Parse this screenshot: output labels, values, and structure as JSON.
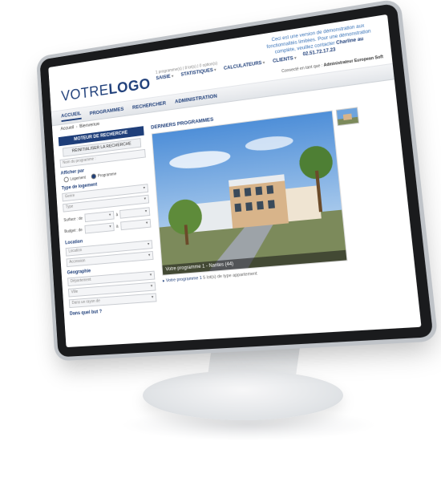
{
  "header": {
    "logo_prefix": "VOTRE",
    "logo_suffix": "LOGO",
    "demo_note": "Ceci est une version de démonstration aux fonctionnalités limitées. Pour une démonstration complète, veuillez contacter",
    "demo_contact": "Charline au 02.51.72.17.23",
    "mini_links": "1 programme(s) | 8 lot(s) | 0 option(s)",
    "connected_label": "Connecté en tant que :",
    "connected_user": "Administrateur European Soft"
  },
  "top_menu": [
    "SAISIE",
    "STATISTIQUES",
    "CALCULATEURS",
    "CLIENTS"
  ],
  "nav": {
    "items": [
      "ACCUEIL",
      "PROGRAMMES",
      "RECHERCHER",
      "ADMINISTRATION"
    ]
  },
  "breadcrumb": {
    "home": "Accueil",
    "current": "Bienvenue"
  },
  "search": {
    "title": "MOTEUR DE RECHERCHE",
    "reset": "RÉINITIALISER LA RECHERCHE",
    "program_name_placeholder": "Nom du programme :",
    "display_title": "Afficher par",
    "display_opt_1": "Logement",
    "display_opt_2": "Programme",
    "type_title": "Type de logement",
    "type_genre": "Genre",
    "type_type": "Type",
    "surface_label": "Surface : de",
    "budget_label": "Budget : de",
    "to_label": "à",
    "location_title": "Location",
    "location_field": "Location",
    "accession_field": "Accession",
    "geo_title": "Géographie",
    "dept_field": "Département",
    "city_field": "Ville",
    "radius_field": "Dans un rayon de",
    "why_title": "Dans quel but ?"
  },
  "programs": {
    "title": "DERNIERS PROGRAMMES",
    "caption": "Votre programme 1 - Nantes (44)",
    "link": "Votre programme 1",
    "link_detail": "5 lot(s) de type appartement"
  }
}
